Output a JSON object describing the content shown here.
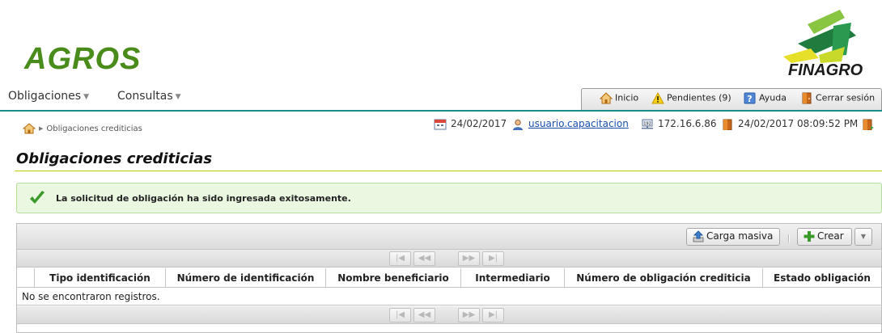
{
  "brand": {
    "agros": "AGROS",
    "finagro": "FINAGRO"
  },
  "menu": [
    {
      "label": "Obligaciones"
    },
    {
      "label": "Consultas"
    }
  ],
  "toolbar": {
    "inicio": "Inicio",
    "pendientes": "Pendientes (9)",
    "ayuda": "Ayuda",
    "cerrar": "Cerrar sesión"
  },
  "breadcrumb": {
    "current": "Obligaciones crediticias"
  },
  "status": {
    "date": "24/02/2017",
    "user": "usuario.capacitacion",
    "ip": "172.16.6.86",
    "datetime": "24/02/2017 08:09:52 PM"
  },
  "page": {
    "title": "Obligaciones crediticias"
  },
  "message": {
    "text": "La solicitud de obligación ha sido ingresada exitosamente."
  },
  "grid": {
    "carga_masiva": "Carga masiva",
    "crear": "Crear",
    "columns": [
      "Tipo identificación",
      "Número de identificación",
      "Nombre beneficiario",
      "Intermediario",
      "Número de obligación crediticia",
      "Estado obligación"
    ],
    "empty": "No se encontraron registros."
  },
  "colors": {
    "accent_teal": "#1c8c8a",
    "agros_green": "#4a8c1c",
    "success_bg": "#eaf8e1"
  }
}
